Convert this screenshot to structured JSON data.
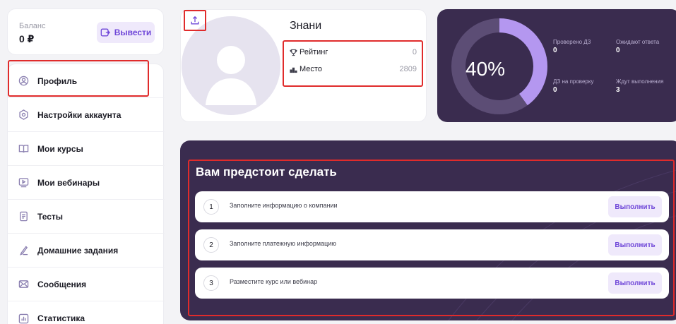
{
  "balance": {
    "label": "Баланс",
    "value": "0 ₽",
    "withdraw_label": "Вывести"
  },
  "sidebar": {
    "items": [
      {
        "label": "Профиль",
        "icon": "user-circle-icon"
      },
      {
        "label": "Настройки аккаунта",
        "icon": "settings-icon"
      },
      {
        "label": "Мои курсы",
        "icon": "book-icon"
      },
      {
        "label": "Мои вебинары",
        "icon": "video-play-icon"
      },
      {
        "label": "Тесты",
        "icon": "document-icon"
      },
      {
        "label": "Домашние задания",
        "icon": "pencil-icon"
      },
      {
        "label": "Сообщения",
        "icon": "envelope-icon"
      },
      {
        "label": "Статистика",
        "icon": "bar-chart-icon"
      }
    ]
  },
  "profile": {
    "name": "Знани",
    "rating_label": "Рейтинг",
    "rating_value": "0",
    "place_label": "Место",
    "place_value": "2809"
  },
  "progress": {
    "percent": 40,
    "percent_label": "40%",
    "stats": [
      {
        "label": "Проверено ДЗ",
        "value": "0"
      },
      {
        "label": "Ожидают ответа",
        "value": "0"
      },
      {
        "label": "ДЗ на проверку",
        "value": "0"
      },
      {
        "label": "Ждут выполнения",
        "value": "3"
      }
    ]
  },
  "todo": {
    "title": "Вам предстоит сделать",
    "tasks": [
      {
        "num": "1",
        "text": "Заполните информацию о компании",
        "button": "Выполнить"
      },
      {
        "num": "2",
        "text": "Заполните платежную информацию",
        "button": "Выполнить"
      },
      {
        "num": "3",
        "text": "Разместите курс или вебинар",
        "button": "Выполнить"
      }
    ]
  },
  "colors": {
    "accent": "#6f47d8",
    "accent_light": "#efe9fb",
    "dark_card": "#3a2c4f",
    "ring_fill": "#b497f0",
    "highlight": "#e02b2b"
  }
}
